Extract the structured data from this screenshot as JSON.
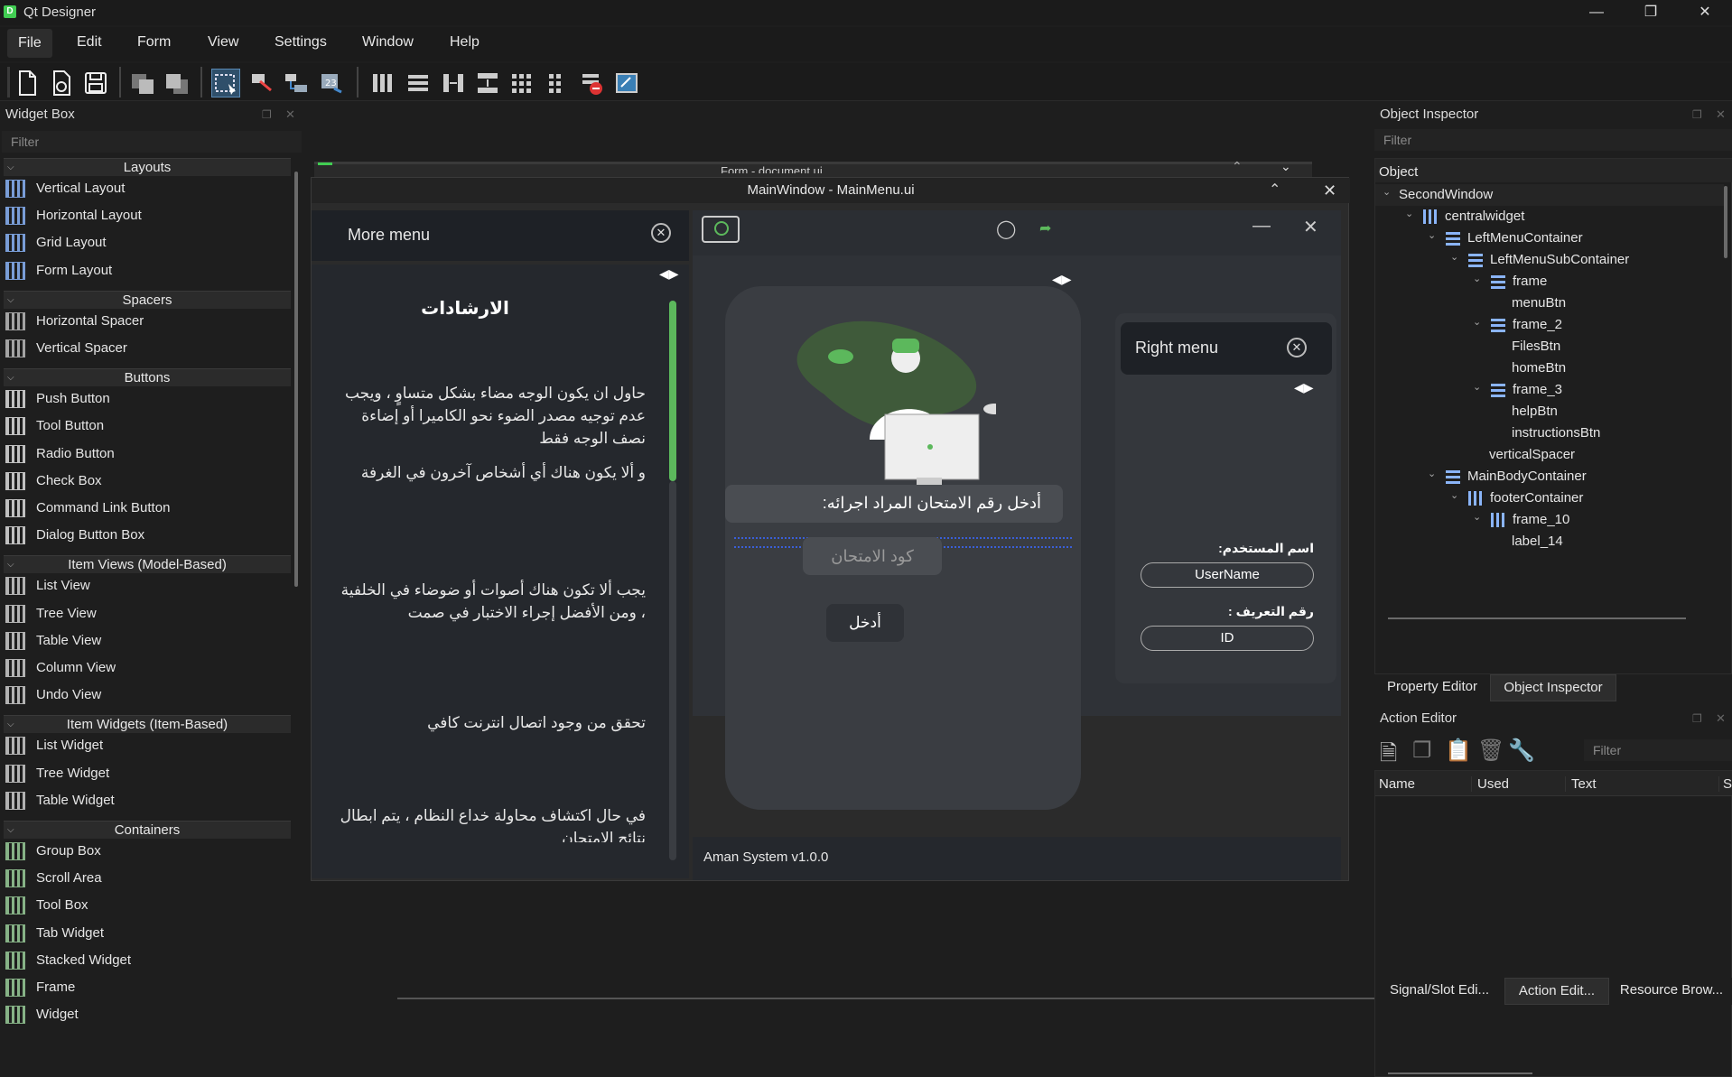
{
  "window": {
    "title": "Qt Designer"
  },
  "menu": [
    "File",
    "Edit",
    "Form",
    "View",
    "Settings",
    "Window",
    "Help"
  ],
  "widget_box": {
    "title": "Widget Box",
    "filter_placeholder": "Filter",
    "categories": [
      {
        "name": "Layouts",
        "items": [
          "Vertical Layout",
          "Horizontal Layout",
          "Grid Layout",
          "Form Layout"
        ]
      },
      {
        "name": "Spacers",
        "items": [
          "Horizontal Spacer",
          "Vertical Spacer"
        ]
      },
      {
        "name": "Buttons",
        "items": [
          "Push Button",
          "Tool Button",
          "Radio Button",
          "Check Box",
          "Command Link Button",
          "Dialog Button Box"
        ]
      },
      {
        "name": "Item Views (Model-Based)",
        "items": [
          "List View",
          "Tree View",
          "Table View",
          "Column View",
          "Undo View"
        ]
      },
      {
        "name": "Item Widgets (Item-Based)",
        "items": [
          "List Widget",
          "Tree Widget",
          "Table Widget"
        ]
      },
      {
        "name": "Containers",
        "items": [
          "Group Box",
          "Scroll Area",
          "Tool Box",
          "Tab Widget",
          "Stacked Widget",
          "Frame",
          "Widget"
        ]
      }
    ]
  },
  "background_form": {
    "title": "Form - document.ui"
  },
  "form": {
    "title": "MainWindow - MainMenu.ui",
    "more_menu": "More menu",
    "guidelines_title": "الارشادات",
    "guidelines": [
      "حاول ان يكون الوجه مضاء بشكل متساوٍ ، ويجب عدم توجيه مصدر الضوء نحو الكاميرا أو إضاءة نصف الوجه فقط",
      "و ألا يكون هناك أي أشخاص آخرون في الغرفة",
      "يجب ألا تكون هناك أصوات أو ضوضاء في الخلفية ، ومن الأفضل إجراء الاختبار في صمت",
      "تحقق من وجود اتصال انترنت كافي",
      "في حال اكتشاف محاولة خداع النظام ، يتم ابطال نتائج الامتحان"
    ],
    "exam_prompt": "أدخل رقم الامتحان المراد اجرائه:",
    "exam_code_placeholder": "كود الامتحان",
    "enter_button": "أدخل",
    "right_menu": "Right menu",
    "username_label": "اسم المستخدم:",
    "username_value": "UserName",
    "id_label": "رقم التعريف :",
    "id_value": "ID",
    "footer": "Aman System v1.0.0"
  },
  "object_inspector": {
    "title": "Object Inspector",
    "filter_placeholder": "Filter",
    "header": "Object",
    "tree": [
      {
        "name": "SecondWindow",
        "depth": 0,
        "icon": "none",
        "arrow": true
      },
      {
        "name": "centralwidget",
        "depth": 1,
        "icon": "hbox",
        "arrow": true
      },
      {
        "name": "LeftMenuContainer",
        "depth": 2,
        "icon": "vbox",
        "arrow": true
      },
      {
        "name": "LeftMenuSubContainer",
        "depth": 3,
        "icon": "vbox",
        "arrow": true
      },
      {
        "name": "frame",
        "depth": 4,
        "icon": "vbox",
        "arrow": true
      },
      {
        "name": "menuBtn",
        "depth": 5,
        "icon": "none",
        "arrow": false
      },
      {
        "name": "frame_2",
        "depth": 4,
        "icon": "vbox",
        "arrow": true
      },
      {
        "name": "FilesBtn",
        "depth": 5,
        "icon": "none",
        "arrow": false
      },
      {
        "name": "homeBtn",
        "depth": 5,
        "icon": "none",
        "arrow": false
      },
      {
        "name": "frame_3",
        "depth": 4,
        "icon": "vbox",
        "arrow": true
      },
      {
        "name": "helpBtn",
        "depth": 5,
        "icon": "none",
        "arrow": false
      },
      {
        "name": "instructionsBtn",
        "depth": 5,
        "icon": "none",
        "arrow": false
      },
      {
        "name": "verticalSpacer",
        "depth": 4,
        "icon": "none",
        "arrow": false
      },
      {
        "name": "MainBodyContainer",
        "depth": 2,
        "icon": "vbox",
        "arrow": true
      },
      {
        "name": "footerContainer",
        "depth": 3,
        "icon": "hbox",
        "arrow": true
      },
      {
        "name": "frame_10",
        "depth": 4,
        "icon": "hbox",
        "arrow": true
      },
      {
        "name": "label_14",
        "depth": 5,
        "icon": "none",
        "arrow": false
      }
    ],
    "tabs": [
      "Property Editor",
      "Object Inspector"
    ]
  },
  "action_editor": {
    "title": "Action Editor",
    "filter_placeholder": "Filter",
    "columns": [
      "Name",
      "Used",
      "Text",
      "Sh"
    ]
  },
  "bottom_tabs": [
    "Signal/Slot Edi...",
    "Action Edit...",
    "Resource Brow..."
  ],
  "colors": {
    "accent_green": "#5cb85c",
    "panel": "#1e1e1e",
    "form_bg": "#2b2b2b"
  }
}
